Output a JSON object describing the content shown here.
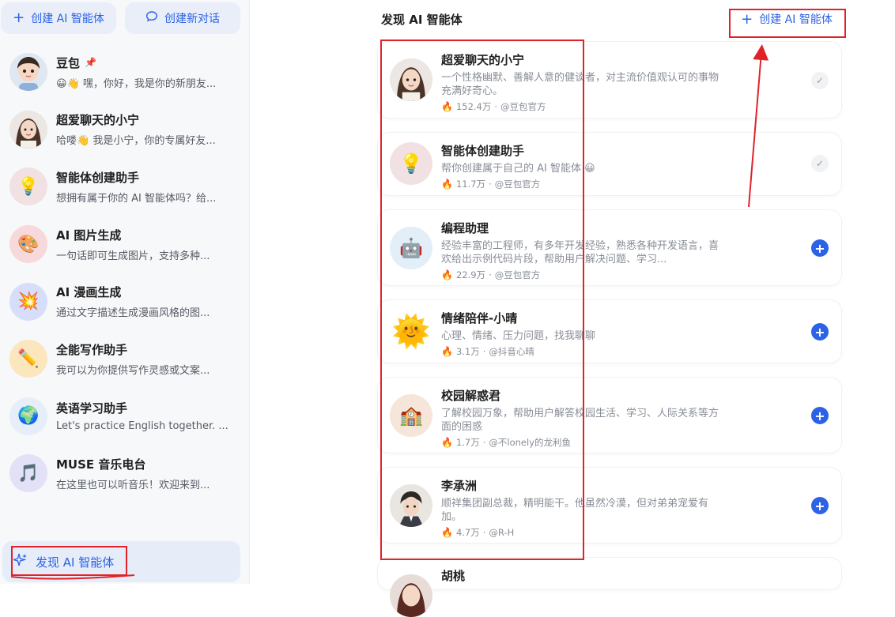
{
  "sidebar": {
    "create_label": "创建 AI 智能体",
    "new_chat_label": "创建新对话",
    "items": [
      {
        "name": "豆包",
        "desc": "😀👋 嘿，你好，我是你的新朋友...",
        "icon": "doubao-avatar",
        "pinned": true
      },
      {
        "name": "超爱聊天的小宁",
        "desc": "哈喽👋 我是小宁，你的专属好友...",
        "icon": "girl-avatar"
      },
      {
        "name": "智能体创建助手",
        "desc": "想拥有属于你的 AI 智能体吗？给...",
        "icon": "lightbulb-avatar"
      },
      {
        "name": "AI 图片生成",
        "desc": "一句话即可生成图片，支持多种...",
        "icon": "palette-avatar"
      },
      {
        "name": "AI 漫画生成",
        "desc": "通过文字描述生成漫画风格的图...",
        "icon": "comic-avatar"
      },
      {
        "name": "全能写作助手",
        "desc": "我可以为你提供写作灵感或文案...",
        "icon": "pencil-avatar"
      },
      {
        "name": "英语学习助手",
        "desc": "Let's practice English together. ...",
        "icon": "globe-avatar"
      },
      {
        "name": "MUSE 音乐电台",
        "desc": "在这里也可以听音乐！欢迎来到...",
        "icon": "music-avatar"
      }
    ],
    "discover_label": "发现 AI 智能体"
  },
  "main": {
    "title": "发现 AI 智能体",
    "create_label": "创建 AI 智能体",
    "cards": [
      {
        "name": "超爱聊天的小宁",
        "desc": "一个性格幽默、善解人意的健谈者，对主流价值观认可的事物充满好奇心。",
        "count": "152.4万",
        "author": "@豆包官方",
        "status": "added",
        "icon": "girl-avatar"
      },
      {
        "name": "智能体创建助手",
        "desc": "帮你创建属于自己的 AI 智能体 😀",
        "count": "11.7万",
        "author": "@豆包官方",
        "status": "added",
        "icon": "lightbulb-avatar"
      },
      {
        "name": "编程助理",
        "desc": "经验丰富的工程师，有多年开发经验，熟悉各种开发语言，喜欢给出示例代码片段，帮助用户解决问题、学习...",
        "count": "22.9万",
        "author": "@豆包官方",
        "status": "add",
        "icon": "robot-avatar"
      },
      {
        "name": "情绪陪伴-小晴",
        "desc": "心理、情绪、压力问题，找我聊聊",
        "count": "3.1万",
        "author": "@抖音心晴",
        "status": "add",
        "icon": "sun-avatar"
      },
      {
        "name": "校园解惑君",
        "desc": "了解校园万象，帮助用户解答校园生活、学习、人际关系等方面的困惑",
        "count": "1.7万",
        "author": "@不lonely的龙利鱼",
        "status": "add",
        "icon": "school-avatar"
      },
      {
        "name": "李承洲",
        "desc": "顺祥集团副总裁，精明能干。他虽然冷漠，但对弟弟宠爱有加。",
        "count": "4.7万",
        "author": "@R-H",
        "status": "add",
        "icon": "man-avatar"
      },
      {
        "name": "胡桃",
        "desc": "",
        "count": "",
        "author": "",
        "status": "add",
        "icon": "girl-avatar"
      }
    ],
    "meta_separator": "·"
  },
  "colors": {
    "accent": "#2b62e6",
    "annotation": "#e0232a"
  }
}
